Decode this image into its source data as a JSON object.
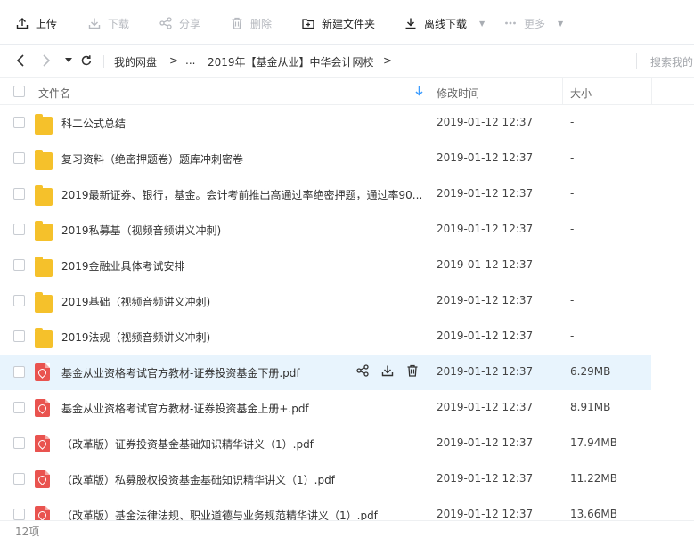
{
  "toolbar": {
    "upload": "上传",
    "download": "下载",
    "share": "分享",
    "delete": "删除",
    "new_folder": "新建文件夹",
    "offline_download": "离线下载",
    "more": "更多"
  },
  "nav": {
    "crumbs": [
      "我的网盘",
      ">",
      "...",
      "2019年【基金从业】中华会计网校",
      ">"
    ],
    "search_placeholder": "搜索我的"
  },
  "table": {
    "col_name": "文件名",
    "col_modified": "修改时间",
    "col_size": "大小"
  },
  "files": [
    {
      "type": "folder",
      "name": "科二公式总结",
      "date": "2019-01-12 12:37",
      "size": "-"
    },
    {
      "type": "folder",
      "name": "复习资料（绝密押题卷）题库冲刺密卷",
      "date": "2019-01-12 12:37",
      "size": "-"
    },
    {
      "type": "folder",
      "name": "2019最新证券、银行，基金。会计考前推出高通过率绝密押题，通过率90...",
      "date": "2019-01-12 12:37",
      "size": "-"
    },
    {
      "type": "folder",
      "name": "2019私募基（视频音频讲义冲刺)",
      "date": "2019-01-12 12:37",
      "size": "-"
    },
    {
      "type": "folder",
      "name": "2019金融业具体考试安排",
      "date": "2019-01-12 12:37",
      "size": "-"
    },
    {
      "type": "folder",
      "name": "2019基础（视频音频讲义冲刺)",
      "date": "2019-01-12 12:37",
      "size": "-"
    },
    {
      "type": "folder",
      "name": "2019法规（视频音频讲义冲刺)",
      "date": "2019-01-12 12:37",
      "size": "-"
    },
    {
      "type": "pdf",
      "name": "基金从业资格考试官方教材-证券投资基金下册.pdf",
      "date": "2019-01-12 12:37",
      "size": "6.29MB"
    },
    {
      "type": "pdf",
      "name": "基金从业资格考试官方教材-证券投资基金上册+.pdf",
      "date": "2019-01-12 12:37",
      "size": "8.91MB"
    },
    {
      "type": "pdf",
      "name": "（改革版）证券投资基金基础知识精华讲义（1）.pdf",
      "date": "2019-01-12 12:37",
      "size": "17.94MB"
    },
    {
      "type": "pdf",
      "name": "（改革版）私募股权投资基金基础知识精华讲义（1）.pdf",
      "date": "2019-01-12 12:37",
      "size": "11.22MB"
    },
    {
      "type": "pdf",
      "name": "（改革版）基金法律法规、职业道德与业务规范精华讲义（1）.pdf",
      "date": "2019-01-12 12:37",
      "size": "13.66MB"
    }
  ],
  "status": {
    "count": "12项"
  },
  "colors": {
    "accent": "#3b9cff",
    "folder": "#f5c12b",
    "pdf": "#e9534f",
    "row_highlight": "#e8f4fd"
  }
}
